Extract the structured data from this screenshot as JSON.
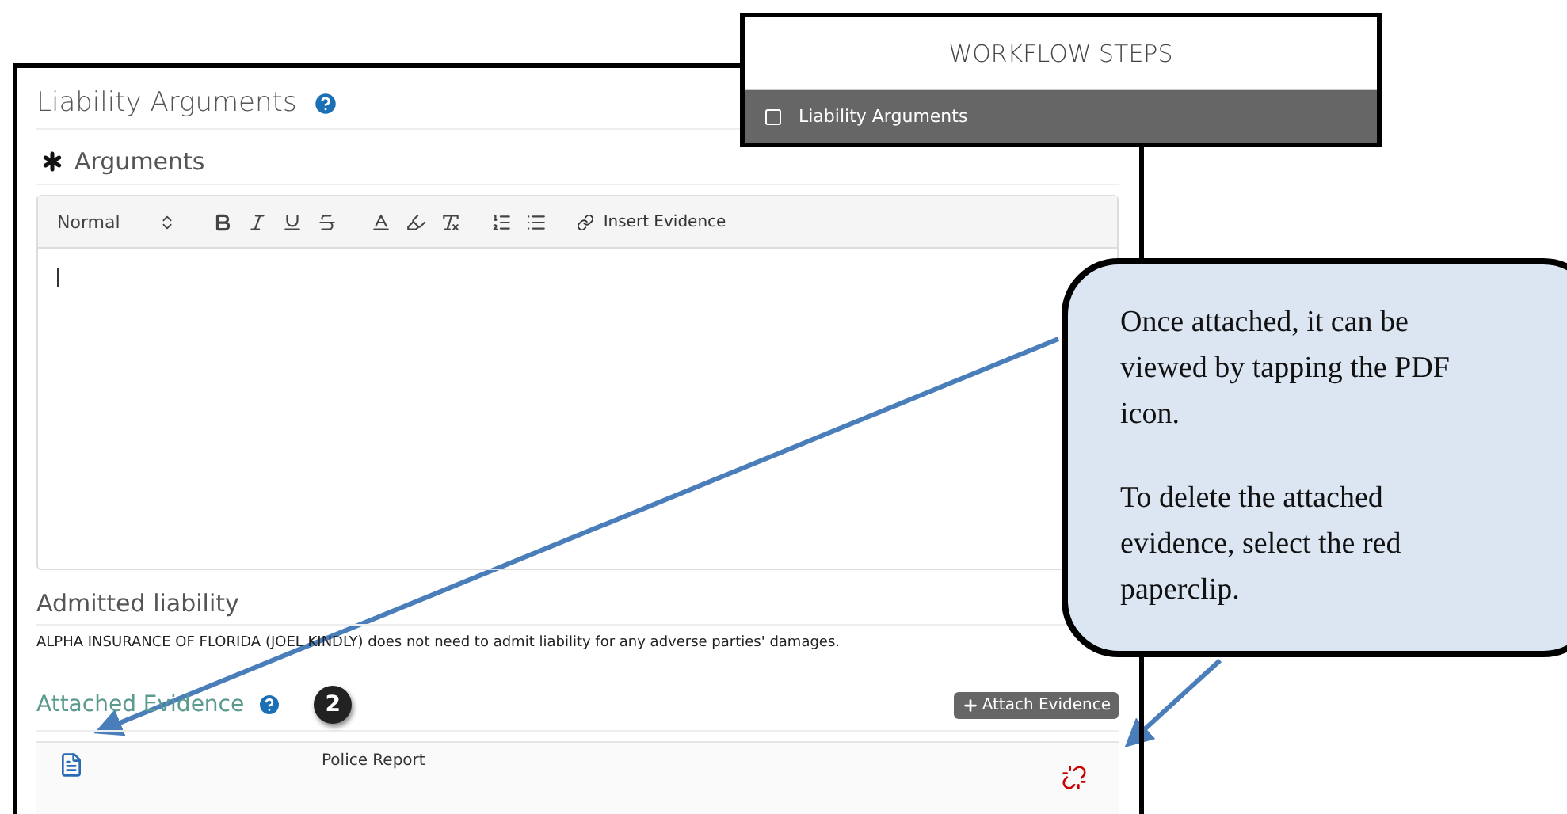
{
  "workflow": {
    "title": "WORKFLOW STEPS",
    "steps": [
      {
        "label": "Liability Arguments",
        "checked": false
      }
    ]
  },
  "panel": {
    "title": "Liability Arguments",
    "field_label": "Arguments",
    "required": true,
    "editor": {
      "format": "Normal",
      "insert_button": "Insert Evidence"
    },
    "admitted": {
      "label": "Admitted liability",
      "text": "ALPHA INSURANCE OF FLORIDA (JOEL KINDLY) does not need to admit liability for any adverse parties' damages."
    },
    "evidence": {
      "label": "Attached Evidence",
      "badge": "2",
      "button": "Attach Evidence",
      "rows": [
        {
          "name": "Police Report"
        }
      ]
    }
  },
  "callout": {
    "paragraphs": [
      "Once attached, it can be viewed by tapping the PDF icon.",
      "To delete the attached evidence, select the red paperclip."
    ]
  }
}
